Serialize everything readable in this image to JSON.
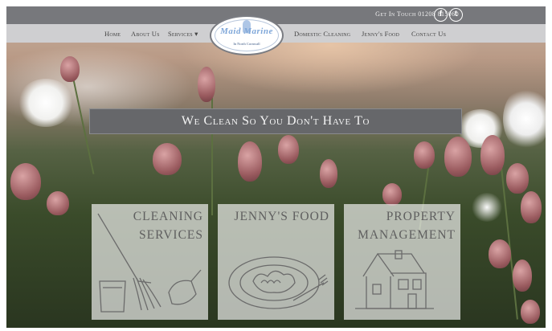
{
  "header": {
    "contact": "Get In Touch 01208 815060",
    "social": [
      {
        "name": "facebook-icon",
        "glyph": "f"
      },
      {
        "name": "twitter-icon",
        "glyph": "t"
      }
    ]
  },
  "logo": {
    "name": "Maid Marine",
    "sub": "In North Cornwall"
  },
  "nav": {
    "home": "Home",
    "about": "About Us",
    "services": "Services ▾",
    "domestic": "Domestic Cleaning",
    "food": "Jenny's Food",
    "contact": "Contact Us"
  },
  "hero": {
    "tagline": "We Clean So You Don't Have To"
  },
  "cards": [
    {
      "line1": "Cleaning",
      "line2": "Services"
    },
    {
      "line1": "Jenny's Food",
      "line2": ""
    },
    {
      "line1": "Property",
      "line2": "Management"
    }
  ],
  "colors": {
    "topbar": "#77787c",
    "navbar": "#cfcfd1",
    "tagline_bg": "#66676a",
    "card_text": "#5f5f5f"
  }
}
